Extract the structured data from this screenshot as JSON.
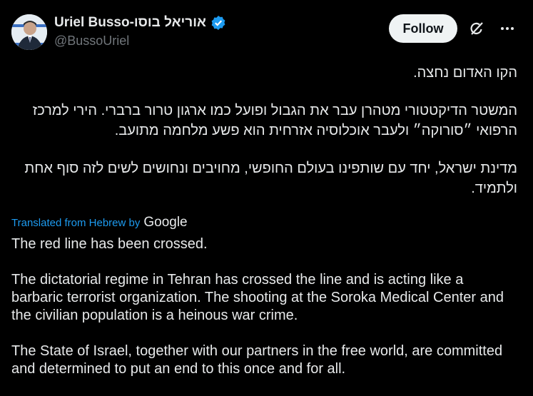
{
  "header": {
    "display_name": "Uriel Busso-אוריאל בוסו",
    "handle": "@BussoUriel",
    "follow_label": "Follow"
  },
  "icons": {
    "verified": "verified-badge-icon",
    "grok": "grok-icon",
    "more": "more-options-icon"
  },
  "colors": {
    "background": "#000000",
    "text": "#e7e9ea",
    "secondary_text": "#71767b",
    "link": "#1d9bf0",
    "verified": "#1d9bf0",
    "follow_bg": "#eff3f4"
  },
  "post": {
    "hebrew_paragraphs": [
      "הקו האדום נחצה.",
      "המשטר הדיקטטורי מטהרן עבר את הגבול ופועל כמו ארגון טרור ברברי. הירי למרכז הרפואי ״סורוקה״ ולעבר אוכלוסיה אזרחית הוא פשע מלחמה מתועב.",
      "מדינת ישראל, יחד עם שותפינו בעולם החופשי, מחויבים ונחושים לשים לזה סוף אחת ולתמיד."
    ],
    "translated_label": "Translated from Hebrew by",
    "translator": "Google",
    "english_paragraphs": [
      "The red line has been crossed.",
      "The dictatorial regime in Tehran has crossed the line and is acting like a barbaric terrorist organization. The shooting at the Soroka Medical Center and the civilian population is a heinous war crime.",
      "The State of Israel, together with our partners in the free world, are committed and determined to put an end to this once and for all."
    ]
  }
}
